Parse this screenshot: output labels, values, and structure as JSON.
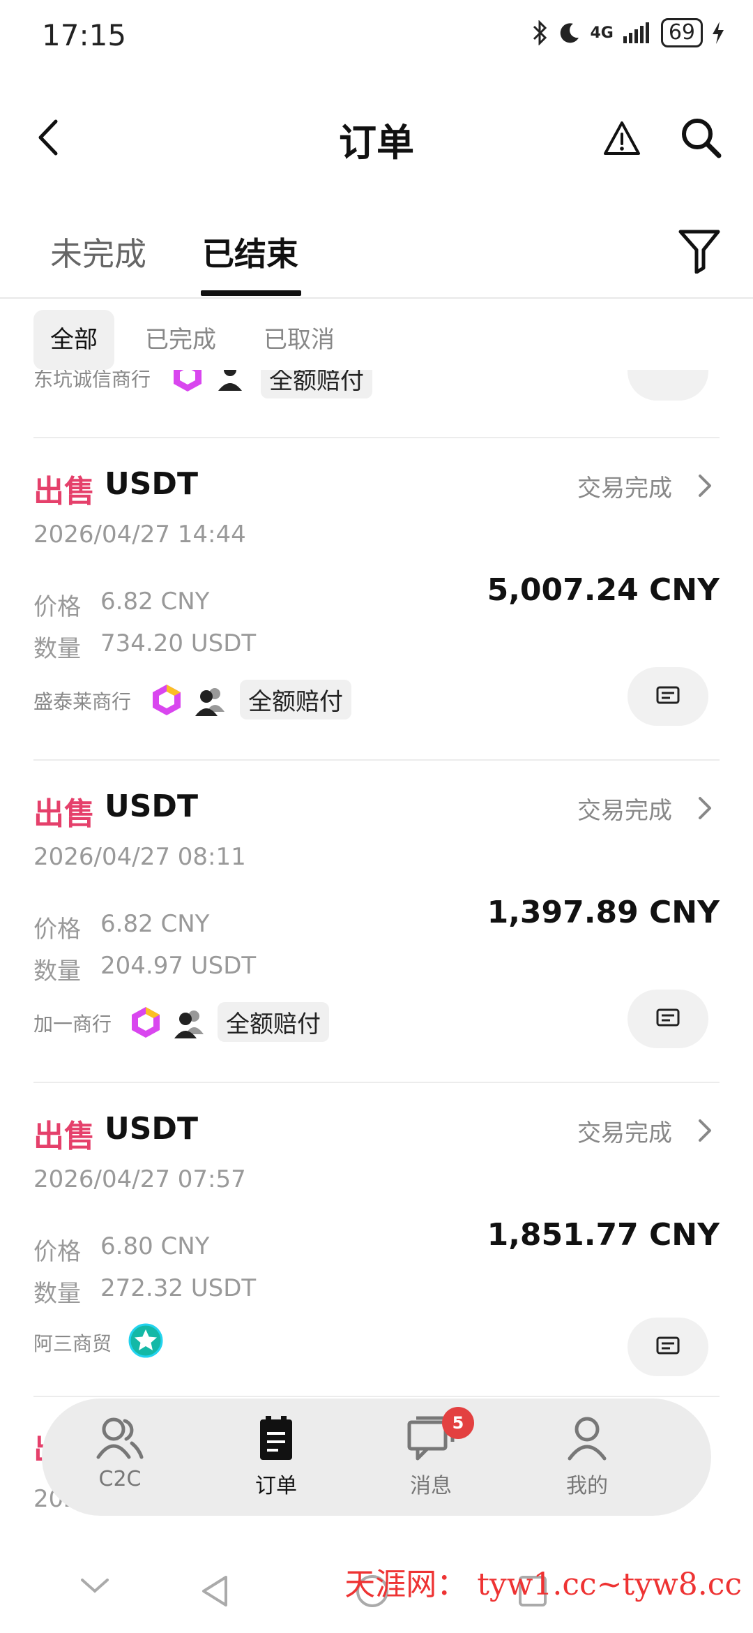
{
  "status_bar": {
    "time": "17:15",
    "network": "4G",
    "battery": "69"
  },
  "header": {
    "title": "订单",
    "icons": [
      "back-arrow-icon",
      "warning-icon",
      "search-icon"
    ]
  },
  "tabs": [
    {
      "label": "未完成",
      "active": false
    },
    {
      "label": "已结束",
      "active": true
    }
  ],
  "sub_tabs": [
    {
      "label": "全部",
      "active": true
    },
    {
      "label": "已完成",
      "active": false
    },
    {
      "label": "已取消",
      "active": false
    }
  ],
  "partial_top_card": {
    "merchant": "东坑诚信商行",
    "guarantee": "全额赔付"
  },
  "orders": [
    {
      "side": "出售",
      "asset": "USDT",
      "status": "交易完成",
      "time": "2026/04/27 14:44",
      "price_label": "价格",
      "price": "6.82 CNY",
      "qty_label": "数量",
      "qty": "734.20 USDT",
      "total": "5,007.24 CNY",
      "merchant": "盛泰莱商行",
      "guarantee": "全额赔付"
    },
    {
      "side": "出售",
      "asset": "USDT",
      "status": "交易完成",
      "time": "2026/04/27 08:11",
      "price_label": "价格",
      "price": "6.82 CNY",
      "qty_label": "数量",
      "qty": "204.97 USDT",
      "total": "1,397.89 CNY",
      "merchant": "加一商行",
      "guarantee": "全额赔付"
    },
    {
      "side": "出售",
      "asset": "USDT",
      "status": "交易完成",
      "time": "2026/04/27 07:57",
      "price_label": "价格",
      "price": "6.80 CNY",
      "qty_label": "数量",
      "qty": "272.32 USDT",
      "total": "1,851.77 CNY",
      "merchant": "阿三商贸"
    }
  ],
  "partial_bottom_card": {
    "side": "出",
    "time": "202"
  },
  "bottom_nav": [
    {
      "label": "C2C",
      "icon": "users-icon",
      "active": false
    },
    {
      "label": "订单",
      "icon": "clipboard-icon",
      "active": true
    },
    {
      "label": "消息",
      "icon": "chat-icon",
      "active": false,
      "badge": "5"
    },
    {
      "label": "我的",
      "icon": "user-icon",
      "active": false
    }
  ],
  "watermark": "天涯网： tyw1.cc~tyw8.cc",
  "colors": {
    "sell": "#e5406b",
    "badge": "#e34040",
    "nav_bg": "#ececec"
  }
}
